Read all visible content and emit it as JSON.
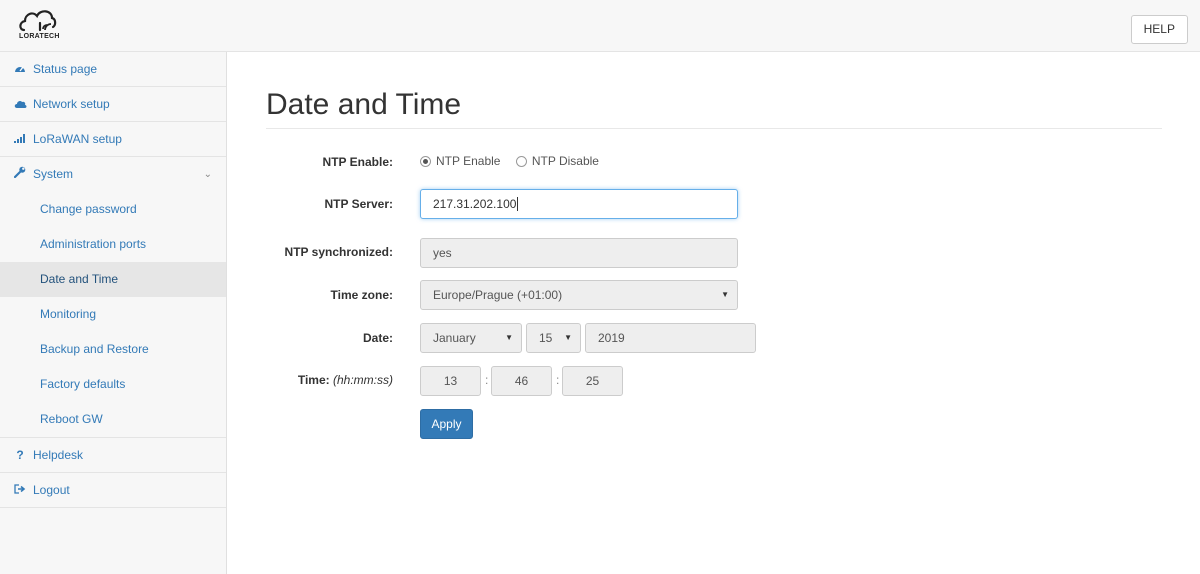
{
  "header": {
    "logo_text": "LORATECH",
    "help_label": "HELP"
  },
  "sidebar": {
    "items": [
      {
        "label": "Status page",
        "icon": "dashboard-icon"
      },
      {
        "label": "Network setup",
        "icon": "cloud-icon"
      },
      {
        "label": "LoRaWAN setup",
        "icon": "signal-icon"
      },
      {
        "label": "System",
        "icon": "wrench-icon"
      }
    ],
    "system_subitems": [
      "Change password",
      "Administration ports",
      "Date and Time",
      "Monitoring",
      "Backup and Restore",
      "Factory defaults",
      "Reboot GW"
    ],
    "active_subitem": "Date and Time",
    "helpdesk_label": "Helpdesk",
    "helpdesk_glyph": "?",
    "logout_label": "Logout"
  },
  "page": {
    "title": "Date and Time",
    "ntp_enable_label": "NTP Enable:",
    "ntp_enable_option": "NTP Enable",
    "ntp_disable_option": "NTP Disable",
    "ntp_enabled": true,
    "ntp_server_label": "NTP Server:",
    "ntp_server_value": "217.31.202.100",
    "ntp_sync_label": "NTP synchronized:",
    "ntp_sync_value": "yes",
    "timezone_label": "Time zone:",
    "timezone_value": "Europe/Prague (+01:00)",
    "date_label": "Date:",
    "date_month": "January",
    "date_day": "15",
    "date_year": "2019",
    "time_label": "Time:",
    "time_format": "(hh:mm:ss)",
    "time_h": "13",
    "time_m": "46",
    "time_s": "25",
    "time_sep": ":",
    "apply_label": "Apply"
  },
  "colors": {
    "link": "#337ab7",
    "primary_button": "#337ab7",
    "active_item_bg": "#e6e6e6"
  }
}
